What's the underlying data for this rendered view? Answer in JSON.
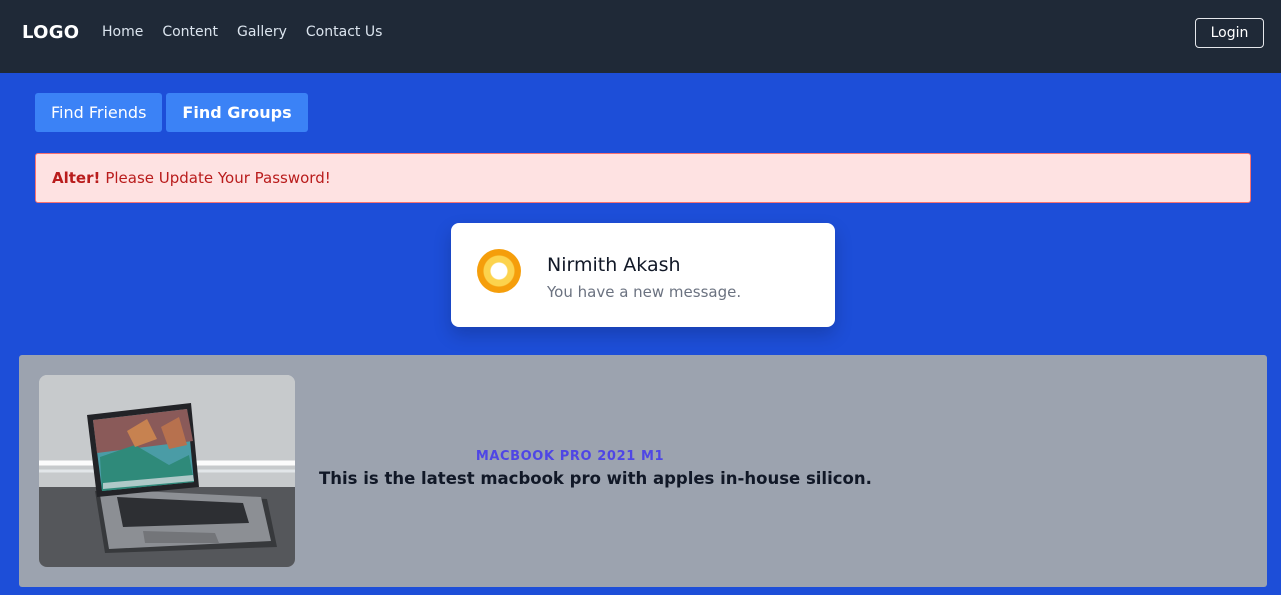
{
  "navbar": {
    "logo": "LOGO",
    "links": [
      "Home",
      "Content",
      "Gallery",
      "Contact Us"
    ],
    "login_label": "Login"
  },
  "tabs": [
    {
      "label": "Find Friends",
      "active": false
    },
    {
      "label": "Find Groups",
      "active": true
    }
  ],
  "alert": {
    "strong": "Alter!",
    "message": "Please Update Your Password!"
  },
  "notification": {
    "name": "Nirmith Akash",
    "message": "You have a new message."
  },
  "product_card": {
    "eyebrow": "MACBOOK PRO 2021 M1",
    "title": "This is the latest macbook pro with apples in-house silicon."
  }
}
